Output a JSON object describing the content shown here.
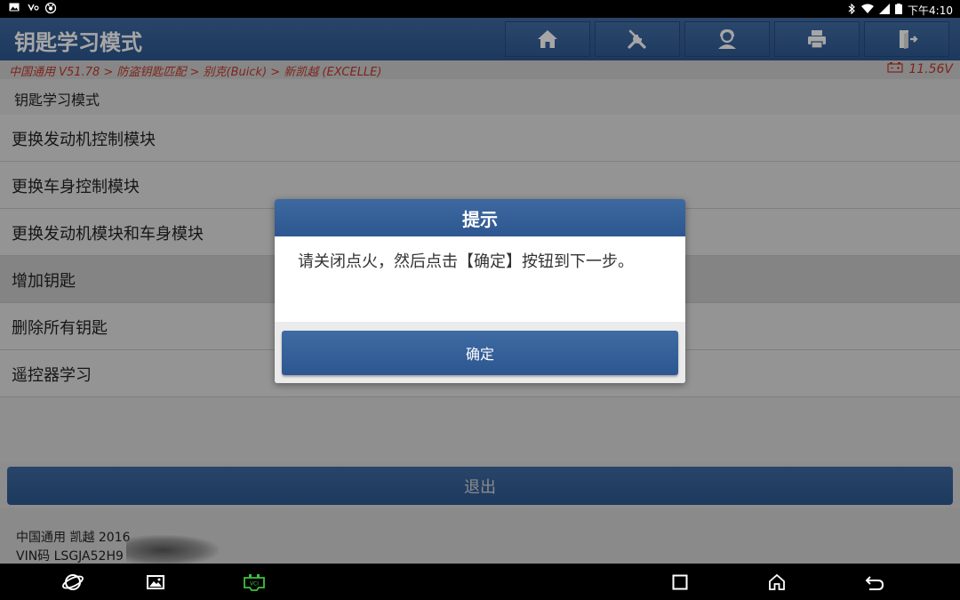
{
  "status_bar": {
    "left_icons": [
      "image-icon",
      "voicemail-icon",
      "usb-debug-icon"
    ],
    "right_icons": [
      "bluetooth-icon",
      "wifi-icon",
      "signal-icon",
      "battery-icon"
    ],
    "time": "下午4:10"
  },
  "header": {
    "title": "钥匙学习模式",
    "tools": [
      "home-icon",
      "diagnose-tools-icon",
      "user-icon",
      "print-icon",
      "exit-icon"
    ]
  },
  "breadcrumb": {
    "path": "中国通用 V51.78 > 防盗钥匙匹配 > 别克(Buick) > 新凯越 (EXCELLE)",
    "voltage": "11.56V"
  },
  "list": {
    "header": "钥匙学习模式",
    "items": [
      {
        "label": "更换发动机控制模块"
      },
      {
        "label": "更换车身控制模块"
      },
      {
        "label": "更换发动机模块和车身模块"
      },
      {
        "label": "增加钥匙"
      },
      {
        "label": "删除所有钥匙"
      },
      {
        "label": "遥控器学习"
      }
    ]
  },
  "exit_button": "退出",
  "footer": {
    "vehicle": "中国通用 凯越 2016",
    "vin": "VIN码 LSGJA52H9"
  },
  "dialog": {
    "title": "提示",
    "message": "请关闭点火，然后点击【确定】按钮到下一步。",
    "ok_label": "确定"
  },
  "colors": {
    "header_blue": "#2d5790",
    "breadcrumb_red": "#c0392b",
    "vci_green": "#3fbf3f"
  },
  "nav_bar": [
    "browser-icon",
    "gallery-icon",
    "vci-icon",
    "recents-icon",
    "home-nav-icon",
    "back-icon"
  ]
}
